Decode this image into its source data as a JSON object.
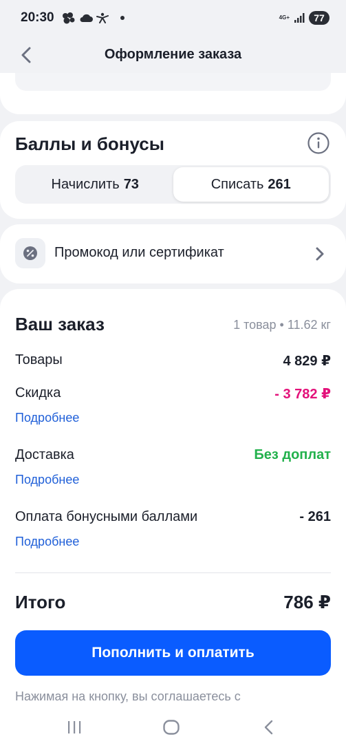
{
  "status_bar": {
    "time": "20:30",
    "network_type": "4G+",
    "battery": "77",
    "icons": [
      "weather-cloud-icon",
      "cloud-icon",
      "figure-icon",
      "dot-icon",
      "signal-icon"
    ]
  },
  "header": {
    "title": "Оформление заказа",
    "back_icon": "chevron-left-icon"
  },
  "bonus": {
    "title": "Баллы и бонусы",
    "info_icon": "info-icon",
    "tabs": [
      {
        "label": "Начислить",
        "value": "73",
        "active": false
      },
      {
        "label": "Списать",
        "value": "261",
        "active": true
      }
    ]
  },
  "promo": {
    "label": "Промокод или сертификат",
    "icon": "percent-icon",
    "chevron": "chevron-right-icon"
  },
  "order": {
    "title": "Ваш заказ",
    "meta": "1 товар • 11.62 кг",
    "rows": {
      "goods": {
        "label": "Товары",
        "value": "4 829 ₽"
      },
      "discount": {
        "label": "Скидка",
        "value": "- 3 782 ₽",
        "more": "Подробнее"
      },
      "delivery": {
        "label": "Доставка",
        "value": "Без доплат",
        "more": "Подробнее"
      },
      "bonus_payment": {
        "label": "Оплата бонусными баллами",
        "value": "- 261",
        "more": "Подробнее"
      }
    },
    "total": {
      "label": "Итого",
      "value": "786 ₽"
    },
    "pay_button": "Пополнить и оплатить",
    "terms": "Нажимая на кнопку, вы соглашаетесь с"
  },
  "colors": {
    "accent": "#0a5cff",
    "discount": "#e3117a",
    "delivery": "#22b14c",
    "link": "#1f5fd8",
    "background": "#f1f2f5"
  },
  "nav_bar": {
    "icons": [
      "recent-apps-icon",
      "home-icon",
      "back-icon"
    ]
  }
}
